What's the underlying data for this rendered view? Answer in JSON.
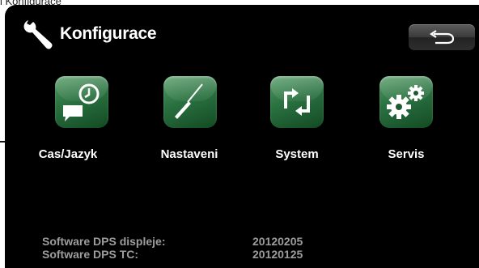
{
  "page": {
    "caption": "i Konfigurace"
  },
  "header": {
    "title": "Konfigurace",
    "title_icon": "wrench-icon",
    "back_icon": "back-arrow-icon"
  },
  "menu": {
    "items": [
      {
        "label": "Cas/Jazyk",
        "icon": "clock-chat-icon"
      },
      {
        "label": "Nastaveni",
        "icon": "screwdriver-icon"
      },
      {
        "label": "System",
        "icon": "cycle-arrows-icon"
      },
      {
        "label": "Servis",
        "icon": "gears-icon"
      }
    ],
    "tile_color": "#2a7140"
  },
  "software": {
    "rows": [
      {
        "label": "Software DPS displeje:",
        "value": "20120205"
      },
      {
        "label": "Software DPS TC:",
        "value": "20120125"
      }
    ]
  }
}
